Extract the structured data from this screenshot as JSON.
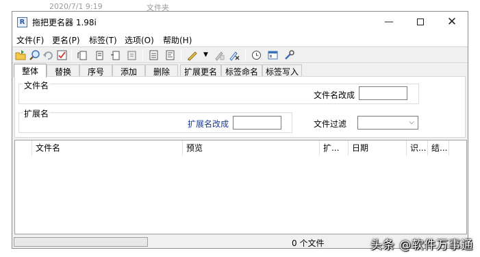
{
  "background": {
    "date": "2020/7/1 9:19",
    "type": "文件夹"
  },
  "window": {
    "title": "拖把更名器 1.98i",
    "icon": "app-icon",
    "controls": {
      "minimize": "—",
      "maximize": "□",
      "close": "✕"
    }
  },
  "menu": [
    {
      "label": "文件(F)"
    },
    {
      "label": "更名(P)"
    },
    {
      "label": "标签(T)"
    },
    {
      "label": "选项(O)"
    },
    {
      "label": "帮助(H)"
    }
  ],
  "toolbar": {
    "icons": [
      "open-folder-icon",
      "search-icon",
      "undo-icon",
      "check-icon",
      "doc-1-icon",
      "doc-2-icon",
      "doc-3-icon",
      "doc-4-icon",
      "page-icon",
      "list-icon",
      "pen-icon",
      "dropdown-arrow-icon",
      "rename-gray-icon",
      "rename-x-icon",
      "clock-icon",
      "window-icon",
      "tools-icon"
    ]
  },
  "tabs": [
    {
      "label": "整体",
      "active": true
    },
    {
      "label": "替换"
    },
    {
      "label": "序号"
    },
    {
      "label": "添加"
    },
    {
      "label": "删除"
    },
    {
      "label": "扩展更名"
    },
    {
      "label": "标签命名"
    },
    {
      "label": "标签写入"
    }
  ],
  "panel": {
    "filename_group": "文件名",
    "filename_change_label": "文件名改成",
    "filename_change_value": "",
    "ext_group": "扩展名",
    "ext_change_label": "扩展名改成",
    "ext_change_value": "",
    "file_filter_label": "文件过滤",
    "file_filter_value": ""
  },
  "list": {
    "columns": [
      "",
      "文件名",
      "预览",
      "扩...",
      "日期",
      "识...",
      "结..."
    ],
    "rows": []
  },
  "status": {
    "progress": 0,
    "file_count": "0 个文件"
  },
  "watermark": "头条 @软件万事通"
}
